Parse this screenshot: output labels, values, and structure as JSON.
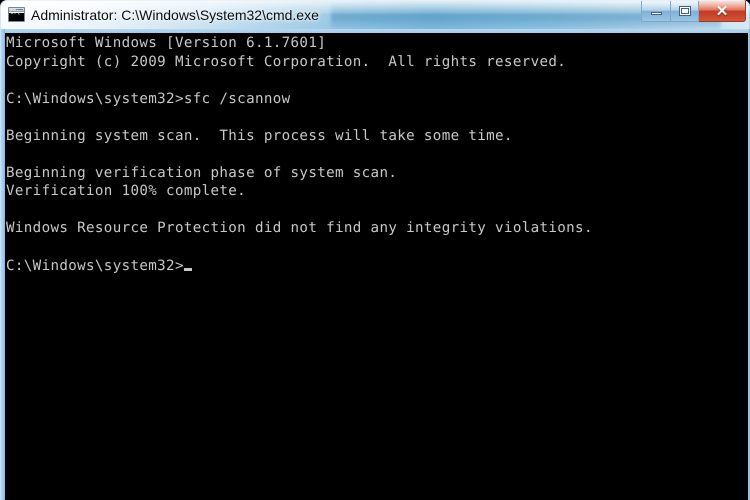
{
  "window": {
    "title": "Administrator: C:\\Windows\\System32\\cmd.exe",
    "icon_name": "cmd-console-icon",
    "icon_glyph": "C:\\",
    "titlebar_accent": "#a9cde4",
    "close_button_color": "#c23a22",
    "buttons": {
      "minimize_label": "–",
      "maximize_label": "□",
      "close_label": "✕",
      "minimize_tooltip": "Minimize",
      "maximize_tooltip": "Maximize",
      "close_tooltip": "Close"
    }
  },
  "console": {
    "background": "#000000",
    "foreground": "#c8c8c8",
    "cursor": "_",
    "lines": [
      "Microsoft Windows [Version 6.1.7601]",
      "Copyright (c) 2009 Microsoft Corporation.  All rights reserved.",
      "",
      "C:\\Windows\\system32>sfc /scannow",
      "",
      "Beginning system scan.  This process will take some time.",
      "",
      "Beginning verification phase of system scan.",
      "Verification 100% complete.",
      "",
      "Windows Resource Protection did not find any integrity violations.",
      "",
      "C:\\Windows\\system32>"
    ],
    "command_entered": "sfc /scannow",
    "prompt": "C:\\Windows\\system32>",
    "verification_percent": "100%",
    "result_message": "Windows Resource Protection did not find any integrity violations."
  }
}
